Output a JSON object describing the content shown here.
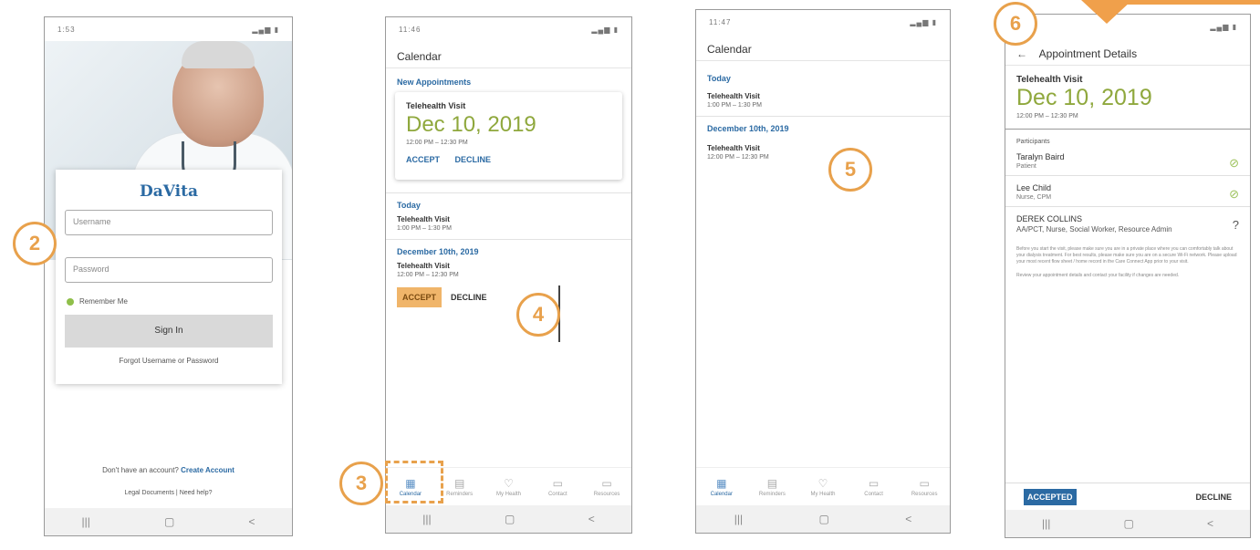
{
  "colors": {
    "brand_blue": "#2b6aa3",
    "date_green": "#8fa83d",
    "annotation_orange": "#e8a14c",
    "check_green": "#9cc25a"
  },
  "nav_icons": [
    "recent-apps-icon",
    "home-icon",
    "back-icon"
  ],
  "nav_glyphs": [
    "|||",
    "▢",
    "<"
  ],
  "login": {
    "status_time": "1:53",
    "brand": "DaVita",
    "username_placeholder": "Username",
    "password_placeholder": "Password",
    "remember": "Remember Me",
    "signin": "Sign In",
    "forgot": "Forgot Username or Password",
    "no_account": "Don't have an account?",
    "create": "Create Account",
    "legal": "Legal Documents",
    "help": "Need help?"
  },
  "calendar1": {
    "status_time": "11:46",
    "title": "Calendar",
    "new_appts": "New Appointments",
    "card": {
      "type": "Telehealth Visit",
      "date": "Dec 10, 2019",
      "time": "12:00 PM – 12:30 PM",
      "accept": "ACCEPT",
      "decline": "DECLINE"
    },
    "today": "Today",
    "today_item": {
      "type": "Telehealth Visit",
      "time": "1:00 PM – 1:30 PM"
    },
    "dec_header": "December 10th, 2019",
    "dec_item": {
      "type": "Telehealth Visit",
      "time": "12:00 PM – 12:30 PM"
    },
    "accept": "ACCEPT",
    "decline": "DECLINE"
  },
  "calendar2": {
    "status_time": "11:47",
    "title": "Calendar",
    "today": "Today",
    "today_item": {
      "type": "Telehealth Visit",
      "time": "1:00 PM – 1:30 PM"
    },
    "dec_header": "December 10th, 2019",
    "dec_item": {
      "type": "Telehealth Visit",
      "time": "12:00 PM – 12:30 PM"
    }
  },
  "tabs": [
    {
      "label": "Calendar",
      "icon": "calendar-icon",
      "glyph": "▦"
    },
    {
      "label": "Reminders",
      "icon": "reminders-icon",
      "glyph": "▤"
    },
    {
      "label": "My Health",
      "icon": "heart-icon",
      "glyph": "♡"
    },
    {
      "label": "Contact",
      "icon": "chat-icon",
      "glyph": "▭"
    },
    {
      "label": "Resources",
      "icon": "resources-icon",
      "glyph": "▭"
    }
  ],
  "details": {
    "title": "Appointment Details",
    "type": "Telehealth Visit",
    "date": "Dec 10, 2019",
    "time": "12:00 PM – 12:30 PM",
    "participants_label": "Participants",
    "participants": [
      {
        "name": "Taralyn Baird",
        "role": "Patient",
        "status": "accepted"
      },
      {
        "name": "Lee Child",
        "role": "Nurse, CPM",
        "status": "accepted"
      },
      {
        "name": "DEREK COLLINS",
        "role": "AA/PCT, Nurse, Social Worker, Resource Admin",
        "status": "pending"
      }
    ],
    "para1": "Before you start the visit, please make sure you are in a private place where you can comfortably talk about your dialysis treatment. For best results, please make sure you are on a secure Wi-Fi network. Please upload your most recent flow sheet / home record in the Care Connect App prior to your visit.",
    "para2": "Review your appointment details and contact your facility if changes are needed.",
    "accepted": "ACCEPTED",
    "decline": "DECLINE"
  },
  "badges": {
    "b2": "2",
    "b3": "3",
    "b4": "4",
    "b5": "5",
    "b6": "6"
  }
}
